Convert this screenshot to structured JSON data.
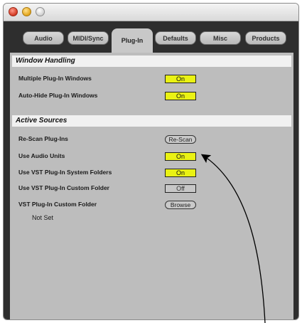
{
  "tabs": [
    {
      "label": "Audio"
    },
    {
      "label": "MIDI/Sync"
    },
    {
      "label": "Plug-In"
    },
    {
      "label": "Defaults"
    },
    {
      "label": "Misc"
    },
    {
      "label": "Products"
    }
  ],
  "active_tab": "Plug-In",
  "window_handling": {
    "title": "Window Handling",
    "rows": [
      {
        "label": "Multiple Plug-In Windows",
        "value": "On"
      },
      {
        "label": "Auto-Hide Plug-In Windows",
        "value": "On"
      }
    ]
  },
  "active_sources": {
    "title": "Active Sources",
    "rescan": {
      "label": "Re-Scan Plug-Ins",
      "button": "Re-Scan"
    },
    "use_audio_units": {
      "label": "Use Audio Units",
      "value": "On"
    },
    "use_vst_system": {
      "label": "Use VST Plug-In System Folders",
      "value": "On"
    },
    "use_vst_custom": {
      "label": "Use VST Plug-In Custom Folder",
      "value": "Off"
    },
    "vst_custom_folder": {
      "label": "VST Plug-In Custom Folder",
      "button": "Browse"
    },
    "folder_path": "Not Set"
  },
  "colors": {
    "on_toggle": "#eaf213",
    "panel_background": "#bdbdbd",
    "window_frame": "#2e2e2e"
  }
}
